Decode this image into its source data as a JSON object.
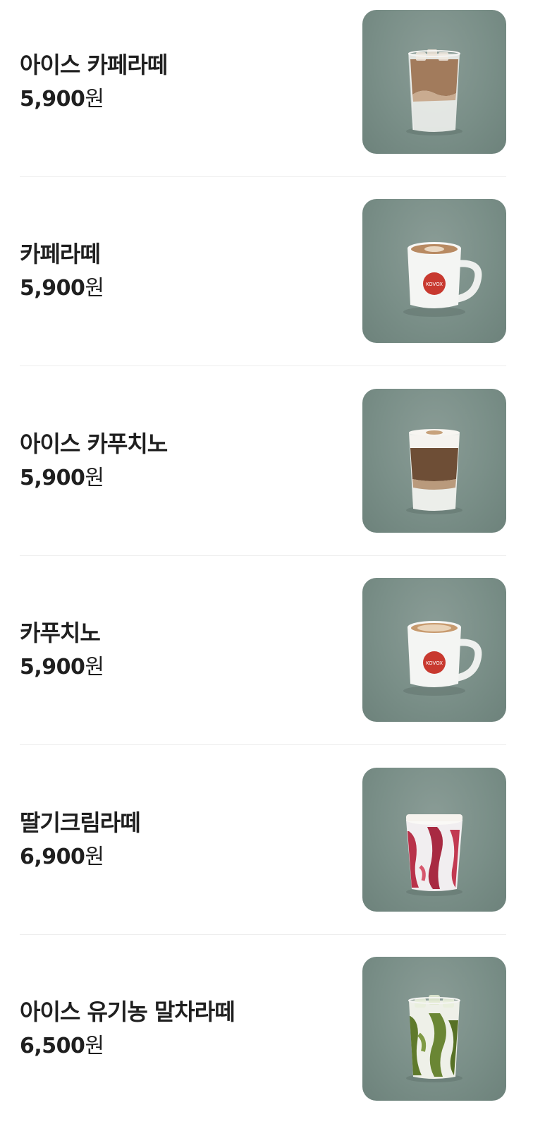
{
  "menu": {
    "items": [
      {
        "name": "아이스 카페라떼",
        "price": "5,900",
        "unit": "원",
        "image_icon": "iced-latte-glass-icon"
      },
      {
        "name": "카페라떼",
        "price": "5,900",
        "unit": "원",
        "image_icon": "hot-latte-mug-icon"
      },
      {
        "name": "아이스 카푸치노",
        "price": "5,900",
        "unit": "원",
        "image_icon": "iced-cappuccino-glass-icon"
      },
      {
        "name": "카푸치노",
        "price": "5,900",
        "unit": "원",
        "image_icon": "hot-cappuccino-mug-icon"
      },
      {
        "name": "딸기크림라떼",
        "price": "6,900",
        "unit": "원",
        "image_icon": "strawberry-cream-latte-cup-icon"
      },
      {
        "name": "아이스 유기농 말차라떼",
        "price": "6,500",
        "unit": "원",
        "image_icon": "iced-matcha-latte-glass-icon"
      }
    ],
    "mug_logo_text": "KOVOX",
    "colors": {
      "thumb_background": "#7a8f88",
      "text": "#1f1f1f",
      "divider": "#eeeeee",
      "mug_logo": "#c8392f"
    }
  }
}
